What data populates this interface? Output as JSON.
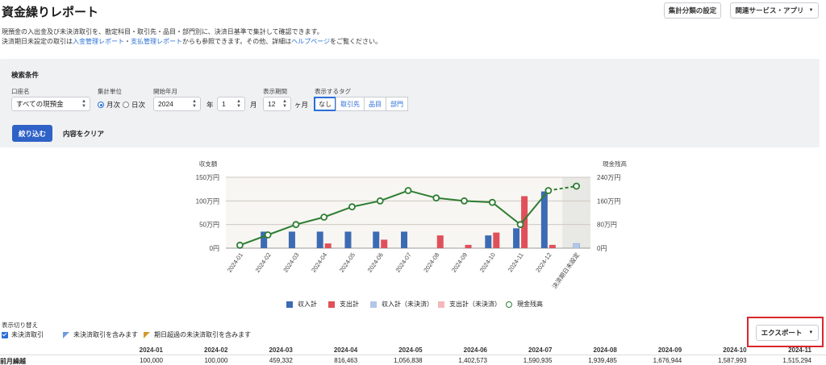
{
  "header": {
    "title": "資金繰りレポート",
    "settings_button": "集計分類の設定",
    "services_button": "関連サービス・アプリ",
    "desc_line1": "現預金の入出金及び未決済取引を、勘定科目・取引先・品目・部門別に、決済日基準で集計して確認できます。",
    "desc2_pre": "決済期日未設定の取引は",
    "desc2_link1": "入金管理レポート",
    "desc2_sep": "・",
    "desc2_link2": "支払管理レポート",
    "desc2_mid": "からも参照できます。その他、詳細は",
    "desc2_link3": "ヘルプページ",
    "desc2_post": "をご覧ください。"
  },
  "search": {
    "title": "検索条件",
    "account_label": "口座名",
    "account_value": "すべての現預金",
    "unit_label": "集計単位",
    "unit_monthly": "月次",
    "unit_daily": "日次",
    "start_label": "開始年月",
    "year_value": "2024",
    "year_unit": "年",
    "month_value": "1",
    "month_unit": "月",
    "period_label": "表示期間",
    "period_value": "12",
    "period_unit": "ヶ月",
    "tags_label": "表示するタグ",
    "tags": [
      "なし",
      "取引先",
      "品目",
      "部門"
    ],
    "apply_button": "絞り込む",
    "clear_button": "内容をクリア"
  },
  "chart_data": {
    "type": "bar",
    "left_axis_title": "収支額",
    "right_axis_title": "現金残高",
    "left_ticks": [
      "0円",
      "50万円",
      "100万円",
      "150万円"
    ],
    "right_ticks": [
      "0円",
      "80万円",
      "160万円",
      "240万円"
    ],
    "ylim_left": [
      0,
      1500000
    ],
    "ylim_right": [
      0,
      2400000
    ],
    "categories": [
      "2024-01",
      "2024-02",
      "2024-03",
      "2024-04",
      "2024-05",
      "2024-06",
      "2024-07",
      "2024-08",
      "2024-09",
      "2024-10",
      "2024-11",
      "2024-12",
      "決済期日未設定"
    ],
    "series": [
      {
        "name": "収入計",
        "color": "#3d6bb3",
        "values": [
          0,
          350000,
          350000,
          350000,
          350000,
          350000,
          350000,
          0,
          0,
          270000,
          420000,
          1200000,
          0
        ]
      },
      {
        "name": "支出計",
        "color": "#e0505a",
        "values": [
          0,
          0,
          0,
          100000,
          0,
          180000,
          0,
          270000,
          70000,
          330000,
          1100000,
          70000,
          0
        ]
      },
      {
        "name": "収入計（未決済）",
        "color": "#b3c8e8",
        "values": [
          0,
          0,
          0,
          0,
          0,
          0,
          0,
          0,
          0,
          0,
          0,
          0,
          100000
        ]
      },
      {
        "name": "支出計（未決済）",
        "color": "#f4b8bb",
        "values": [
          0,
          0,
          0,
          0,
          0,
          0,
          0,
          0,
          0,
          0,
          0,
          0,
          0
        ]
      }
    ],
    "line": {
      "name": "現金残高",
      "color": "#2e7d32",
      "values": [
        100000,
        450000,
        800000,
        1050000,
        1400000,
        1600000,
        1950000,
        1700000,
        1600000,
        1550000,
        800000,
        1950000,
        2100000
      ]
    }
  },
  "bottom": {
    "display_toggle_label": "表示切り替え",
    "unsettled_checkbox": "未決済取引",
    "note_blue": "未決済取引を含みます",
    "note_orange": "期日超過の未決済取引を含みます",
    "export_button": "エクスポート"
  },
  "table": {
    "months": [
      "2024-01",
      "2024-02",
      "2024-03",
      "2024-04",
      "2024-05",
      "2024-06",
      "2024-07",
      "2024-08",
      "2024-09",
      "2024-10",
      "2024-11"
    ],
    "row_label": "前月繰越",
    "row_values": [
      "100,000",
      "100,000",
      "459,332",
      "816,463",
      "1,056,838",
      "1,402,573",
      "1,590,935",
      "1,939,485",
      "1,676,944",
      "1,587,993",
      "1,515,294"
    ]
  }
}
